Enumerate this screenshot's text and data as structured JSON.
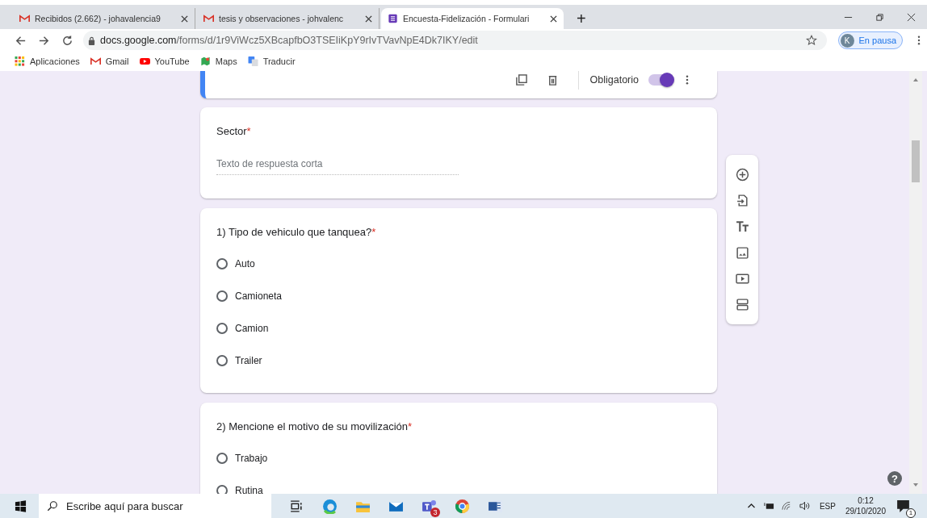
{
  "tabs": [
    {
      "kind": "gmail",
      "title": "Recibidos (2.662) - johavalencia9",
      "selected": false
    },
    {
      "kind": "gmail",
      "title": "tesis y observaciones - johvalenc",
      "selected": false
    },
    {
      "kind": "forms",
      "title": "Encuesta-Fidelización - Formulari",
      "selected": true
    }
  ],
  "new_tab": "+",
  "address": {
    "host": "docs.google.com",
    "path": "/forms/d/1r9ViWcz5XBcapfbO3TSEIiKpY9rIvTVavNpE4Dk7IKY/edit"
  },
  "profile": {
    "initial": "K",
    "label": "En pausa"
  },
  "bookmarks": [
    {
      "kind": "apps",
      "label": "Aplicaciones"
    },
    {
      "kind": "gmail",
      "label": "Gmail"
    },
    {
      "kind": "youtube",
      "label": "YouTube"
    },
    {
      "kind": "maps",
      "label": "Maps"
    },
    {
      "kind": "translate",
      "label": "Traducir"
    }
  ],
  "question_toolbar": {
    "required_label": "Obligatorio",
    "required_on": true
  },
  "questions": [
    {
      "kind": "short",
      "title": "Sector",
      "required_mark": "*",
      "placeholder": "Texto de respuesta corta"
    },
    {
      "kind": "radio",
      "title": "1) Tipo de vehiculo que tanquea?",
      "required_mark": "*",
      "options": [
        {
          "label": "Auto",
          "selected": false
        },
        {
          "label": "Camioneta",
          "selected": false
        },
        {
          "label": "Camion",
          "selected": false
        },
        {
          "label": "Trailer",
          "selected": false
        }
      ]
    },
    {
      "kind": "radio",
      "title": "2) Mencione el motivo de su movilización",
      "required_mark": "*",
      "options": [
        {
          "label": "Trabajo",
          "selected": false
        },
        {
          "label": "Rutina",
          "selected": false
        }
      ]
    }
  ],
  "help": "?",
  "taskbar": {
    "search_placeholder": "Escribe aquí para buscar",
    "teams_badge": "3",
    "language": "ESP",
    "time": "0:12",
    "date": "29/10/2020",
    "notifications": "1"
  }
}
